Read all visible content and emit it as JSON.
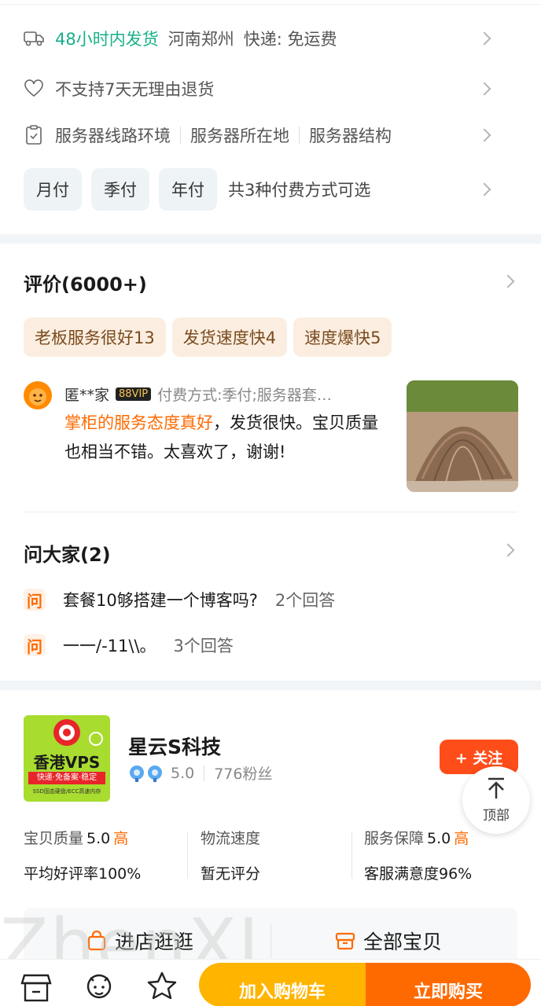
{
  "shipping": {
    "highlight": "48小时内发货",
    "location": "河南郑州",
    "express": "快递: 免运费"
  },
  "returns": {
    "text": "不支持7天无理由退货"
  },
  "params": {
    "items": [
      "服务器线路环境",
      "服务器所在地",
      "服务器结构"
    ]
  },
  "payment": {
    "options": [
      "月付",
      "季付",
      "年付"
    ],
    "summary": "共3种付费方式可选"
  },
  "reviews": {
    "title": "评价(6000+)",
    "tags": [
      "老板服务很好13",
      "发货速度快4",
      "速度爆快5"
    ],
    "item": {
      "user": "匿**家",
      "badge": "88VIP",
      "spec": "付费方式:季付;服务器套…",
      "highlight": "掌柜的服务态度真好",
      "text": "，发货很快。宝贝质量也相当不错。太喜欢了，谢谢!"
    }
  },
  "qa": {
    "title": "问大家(2)",
    "icon_label": "问",
    "items": [
      {
        "question": "套餐10够搭建一个博客吗?",
        "answers": "2个回答"
      },
      {
        "question": "一一/-11\\\\。",
        "answers": "3个回答"
      }
    ]
  },
  "shop": {
    "name": "星云S科技",
    "logo_text": "香港VPS",
    "logo_sub": "快递·免备案·稳定",
    "logo_foot": "SSD固态硬盘/ECC高速内存",
    "rating": "5.0",
    "fans": "776粉丝",
    "follow_label": "+ 关注",
    "top_label": "顶部",
    "metrics": [
      {
        "label": "宝贝质量",
        "value": "5.0",
        "level": "高",
        "sub": "平均好评率100%"
      },
      {
        "label": "物流速度",
        "value": "",
        "level": "",
        "sub": "暂无评分"
      },
      {
        "label": "服务保障",
        "value": "5.0",
        "level": "高",
        "sub": "客服满意度96%"
      }
    ],
    "enter_store": "进店逛逛",
    "all_items": "全部宝贝"
  },
  "watermark": "ZhenXI",
  "bottom_bar": {
    "cart": "加入购物车",
    "buy": "立即购买"
  },
  "colors": {
    "accent": "#ff6a00",
    "green": "#18b08a",
    "cart": "#ffb400"
  }
}
